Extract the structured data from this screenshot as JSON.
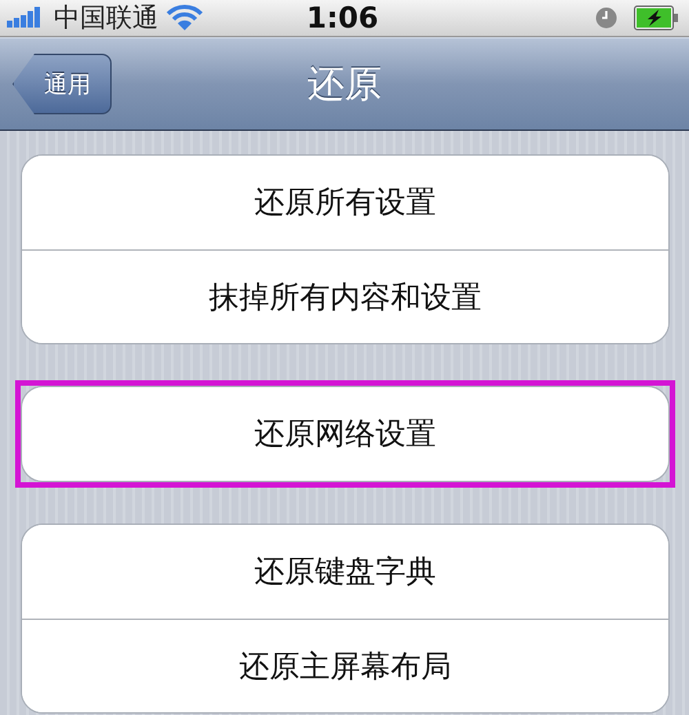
{
  "status_bar": {
    "carrier": "中国联通",
    "time": "1:06",
    "charging": true
  },
  "nav_bar": {
    "back_button": "通用",
    "title": "还原"
  },
  "groups": [
    {
      "highlighted": false,
      "items": [
        "还原所有设置",
        "抹掉所有内容和设置"
      ]
    },
    {
      "highlighted": true,
      "items": [
        "还原网络设置"
      ]
    },
    {
      "highlighted": false,
      "items": [
        "还原键盘字典",
        "还原主屏幕布局"
      ]
    }
  ]
}
